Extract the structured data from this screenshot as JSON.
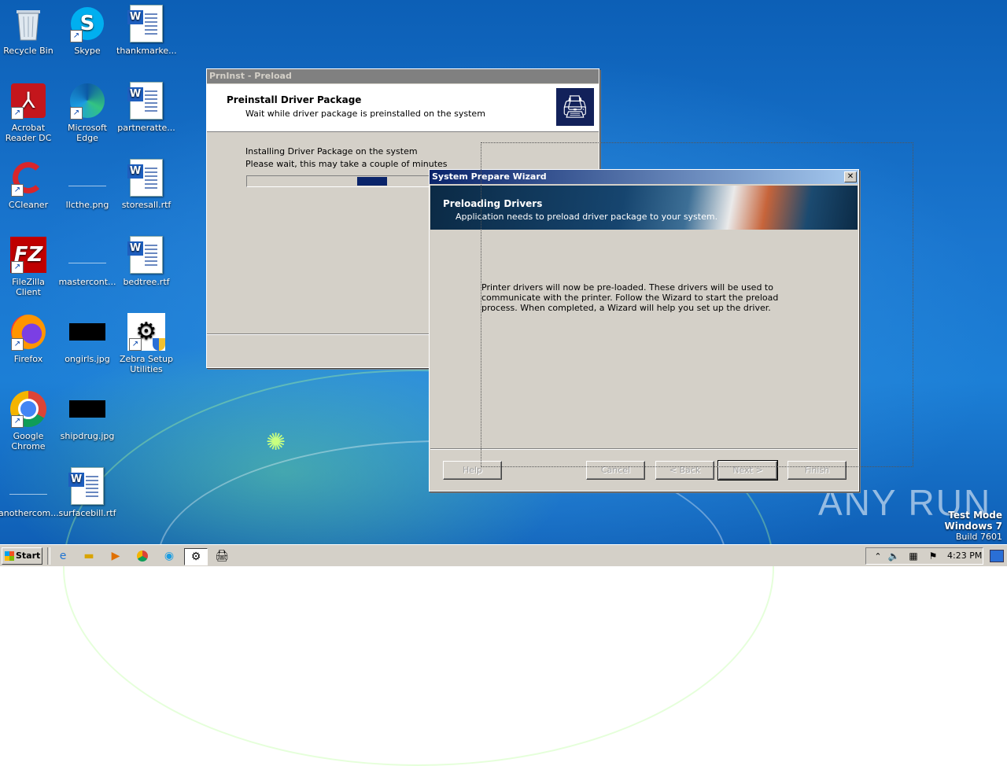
{
  "desktop": {
    "icons": [
      {
        "label": "Recycle Bin"
      },
      {
        "label": "Skype"
      },
      {
        "label": "thankmarke..."
      },
      {
        "label": "Acrobat Reader DC"
      },
      {
        "label": "Microsoft Edge"
      },
      {
        "label": "partneratte..."
      },
      {
        "label": "CCleaner"
      },
      {
        "label": "llcthe.png"
      },
      {
        "label": "storesall.rtf"
      },
      {
        "label": "FileZilla Client"
      },
      {
        "label": "mastercont..."
      },
      {
        "label": "bedtree.rtf"
      },
      {
        "label": "Firefox"
      },
      {
        "label": "ongirls.jpg"
      },
      {
        "label": "Zebra Setup Utilities"
      },
      {
        "label": "Google Chrome"
      },
      {
        "label": "shipdrug.jpg"
      },
      {
        "label": "anothercom..."
      },
      {
        "label": "surfacebill.rtf"
      }
    ],
    "watermark": "ANY RUN",
    "test_mode": {
      "line1": "Test Mode",
      "line2": "Windows 7",
      "line3": "Build 7601"
    }
  },
  "prninst": {
    "title": "PrnInst - Preload",
    "header_title": "Preinstall Driver Package",
    "header_subtitle": "Wait while driver package is preinstalled on the system",
    "line1": "Installing Driver Package on the system",
    "line2": "Please wait, this may take a couple of minutes"
  },
  "wizard": {
    "title": "System Prepare Wizard",
    "close": "✕",
    "header_title": "Preloading Drivers",
    "header_subtitle": "Application needs to preload driver package to your system.",
    "body": "Printer drivers will now be pre-loaded. These drivers will be used to communicate with the printer. Follow the Wizard to start the preload process. When completed, a Wizard will help you set up the driver.",
    "buttons": {
      "help": "Help",
      "cancel": "Cancel",
      "back": "< Back",
      "next": "Next >",
      "finish": "Finish"
    }
  },
  "taskbar": {
    "start": "Start",
    "clock": "4:23 PM"
  }
}
